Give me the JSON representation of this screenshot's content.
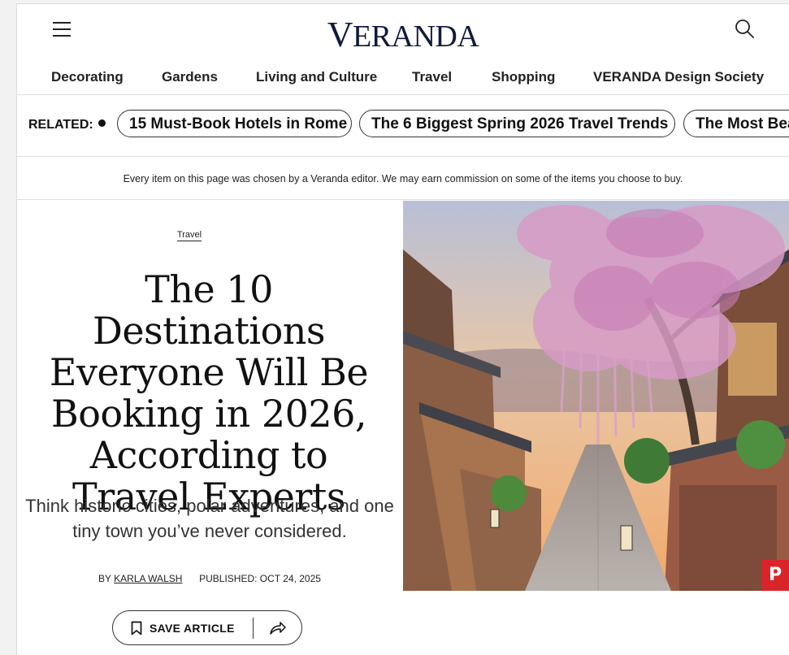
{
  "header": {
    "logo_first": "V",
    "logo_rest": "ERANDA"
  },
  "nav": {
    "items": [
      "Decorating",
      "Gardens",
      "Living and Culture",
      "Travel",
      "Shopping",
      "VERANDA Design Society"
    ]
  },
  "related": {
    "label": "RELATED:",
    "pills": [
      "15 Must-Book Hotels in Rome",
      "The 6 Biggest Spring 2026 Travel Trends",
      "The Most Beautiful"
    ]
  },
  "disclaimer": "Every item on this page was chosen by a Veranda editor. We may earn commission on some of the items you choose to buy.",
  "article": {
    "category": "Travel",
    "headline": "The 10 Destinations Everyone Will Be Booking in 2026, According to Travel Experts",
    "dek": "Think historic cities, polar adventures, and one tiny town you’ve never considered.",
    "by_prefix": "BY",
    "author": "KARLA WALSH",
    "published": "PUBLISHED: OCT 24, 2025",
    "save_label": "SAVE ARTICLE"
  },
  "pin_label": "P",
  "icons": {
    "menu": "hamburger-menu-icon",
    "search": "search-icon",
    "bookmark": "bookmark-icon",
    "share": "share-arrow-icon",
    "pinterest": "pinterest-icon"
  },
  "colors": {
    "logo": "#101a3a",
    "pinterest": "#d9252a"
  }
}
